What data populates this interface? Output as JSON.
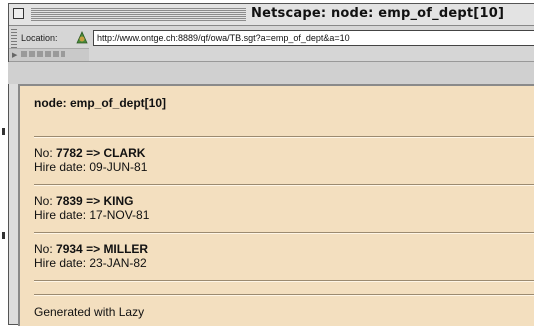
{
  "window": {
    "title": "Netscape: node: emp_of_dept[10]"
  },
  "location": {
    "label": "Location:",
    "url": "http://www.ontge.ch:8889/qf/owa/TB.sgt?a=emp_of_dept&a=10",
    "icon": "netscape-location-icon"
  },
  "page": {
    "node_title": "node: emp_of_dept[10]",
    "employees": [
      {
        "no_label": "No:",
        "no": "7782",
        "arrow": "=>",
        "name": "CLARK",
        "hire_label": "Hire date:",
        "hire_date": "09-JUN-81"
      },
      {
        "no_label": "No:",
        "no": "7839",
        "arrow": "=>",
        "name": "KING",
        "hire_label": "Hire date:",
        "hire_date": "17-NOV-81"
      },
      {
        "no_label": "No:",
        "no": "7934",
        "arrow": "=>",
        "name": "MILLER",
        "hire_label": "Hire date:",
        "hire_date": "23-JAN-82"
      }
    ],
    "footer": "Generated with Lazy"
  },
  "colors": {
    "content_bg": "#f3dfbf",
    "chrome_bg": "#d6d6d6"
  }
}
